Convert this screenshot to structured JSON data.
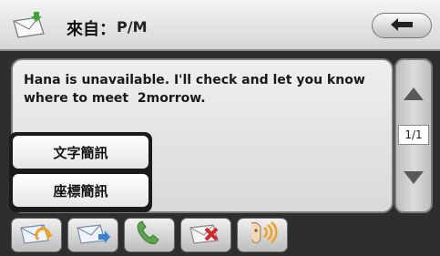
{
  "header": {
    "from_label": "來自：",
    "sender": "P/M",
    "icon": "envelope-arrow-icon",
    "back_icon": "back-arrow-icon"
  },
  "message": {
    "text": "Hana is unavailable. I'll check and let you know\nwhere to meet  2morrow."
  },
  "scroll": {
    "page_indicator": "1/1",
    "up_icon": "scroll-up-icon",
    "down_icon": "scroll-down-icon"
  },
  "popup_menu": {
    "items": [
      {
        "label": "文字簡訊"
      },
      {
        "label": "座標簡訊"
      }
    ]
  },
  "toolbar": {
    "buttons": [
      {
        "icon": "reply-icon"
      },
      {
        "icon": "forward-icon"
      },
      {
        "icon": "call-icon"
      },
      {
        "icon": "delete-icon"
      },
      {
        "icon": "read-aloud-icon"
      }
    ]
  },
  "colors": {
    "accent_blue": "#3b7fd1",
    "call_green": "#5aa64a",
    "delete_red": "#d8262a",
    "speaker_orange": "#f2a11d"
  }
}
